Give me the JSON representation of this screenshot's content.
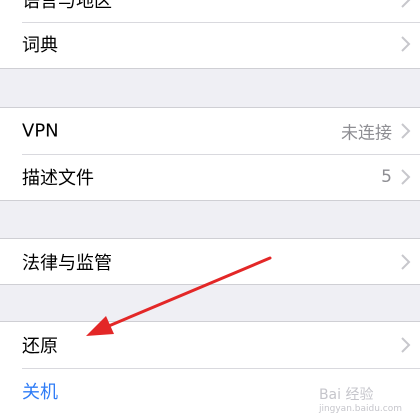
{
  "groups": [
    {
      "rows": [
        {
          "label": "语言与地区"
        },
        {
          "label": "词典"
        }
      ]
    },
    {
      "rows": [
        {
          "label": "VPN",
          "value": "未连接"
        },
        {
          "label": "描述文件",
          "value": "5"
        }
      ]
    },
    {
      "rows": [
        {
          "label": "法律与监管"
        }
      ]
    },
    {
      "rows": [
        {
          "label": "还原"
        },
        {
          "label": "关机"
        }
      ]
    }
  ],
  "colors": {
    "background": "#efeff4",
    "row": "#ffffff",
    "link_blue": "#2f7cf6",
    "annotation_red": "#e32727"
  },
  "watermark": {
    "text": "Bai 经验",
    "sub": "jingyan.baidu.com"
  },
  "annotation": {
    "shape": "arrow",
    "points_to": "还原"
  }
}
